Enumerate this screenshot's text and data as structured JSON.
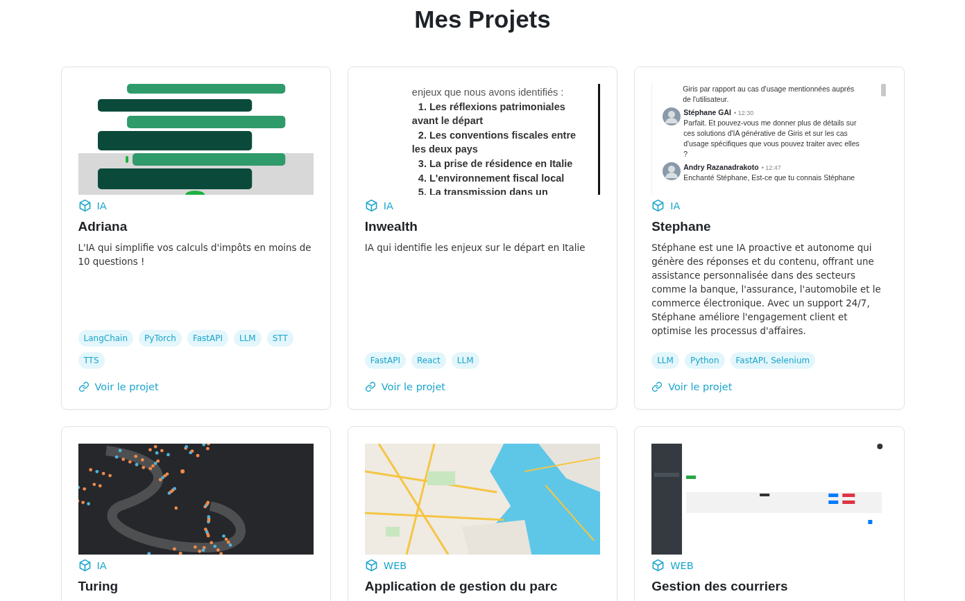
{
  "title": "Mes Projets",
  "projects": [
    {
      "thumbnail": {
        "kind": "chat"
      },
      "category": "IA",
      "name": "Adriana",
      "description": "L'IA qui simplifie vos calculs d'impôts en moins de 10 questions !",
      "tags": [
        "LangChain",
        "PyTorch",
        "FastAPI",
        "LLM",
        "STT",
        "TTS"
      ],
      "link": "Voir le projet"
    },
    {
      "thumbnail": {
        "kind": "document",
        "lines": [
          {
            "text": "enjeux que nous avons identifiés :",
            "bold": false,
            "indent": false
          },
          {
            "text": "1. Les réflexions patrimoniales",
            "bold": true,
            "indent": true
          },
          {
            "text": "avant le départ",
            "bold": true,
            "indent": false
          },
          {
            "text": "2. Les conventions fiscales entre",
            "bold": true,
            "indent": true
          },
          {
            "text": "les deux pays",
            "bold": true,
            "indent": false
          },
          {
            "text": "3. La prise de résidence en Italie",
            "bold": true,
            "indent": true
          },
          {
            "text": "4. L'environnement fiscal local",
            "bold": true,
            "indent": true
          },
          {
            "text": "5. La transmission dans un",
            "bold": true,
            "indent": true
          }
        ]
      },
      "category": "IA",
      "name": "Inwealth",
      "description": "IA qui identifie les enjeux sur le départ en Italie",
      "tags": [
        "FastAPI",
        "React",
        "LLM"
      ],
      "link": "Voir le projet"
    },
    {
      "thumbnail": {
        "kind": "messages",
        "lead": [
          "Giris par rapport au cas d'usage mentionnées auprés",
          "de l'utilisateur."
        ],
        "messages": [
          {
            "author": "Stéphane GAI",
            "time": "• 12:30",
            "lines": [
              "Parfait. Et pouvez-vous me donner plus de détails sur",
              "ces solutions d'IA générative de Giris et sur les cas",
              "d'usage spécifiques que vous pouvez traiter avec elles",
              "?"
            ]
          },
          {
            "author": "Andry Razanadrakoto",
            "time": "• 12:47",
            "lines": [
              "Enchanté Stéphane, Est-ce que tu connais Stéphane"
            ]
          }
        ]
      },
      "category": "IA",
      "name": "Stephane",
      "description": "Stéphane est une IA proactive et autonome qui génère des réponses et du contenu, offrant une assistance personnalisée dans des secteurs comme la banque, l'assurance, l'automobile et le commerce électronique. Avec un support 24/7, Stéphane améliore l'engagement client et optimise les processus d'affaires.",
      "tags": [
        "LLM",
        "Python",
        "FastAPI, Selenium"
      ],
      "link": "Voir le projet"
    },
    {
      "thumbnail": {
        "kind": "graph"
      },
      "category": "IA",
      "name": "Turing"
    },
    {
      "thumbnail": {
        "kind": "map"
      },
      "category": "WEB",
      "name": "Application de gestion du parc"
    },
    {
      "thumbnail": {
        "kind": "dashboard"
      },
      "category": "WEB",
      "name": "Gestion des courriers"
    }
  ]
}
